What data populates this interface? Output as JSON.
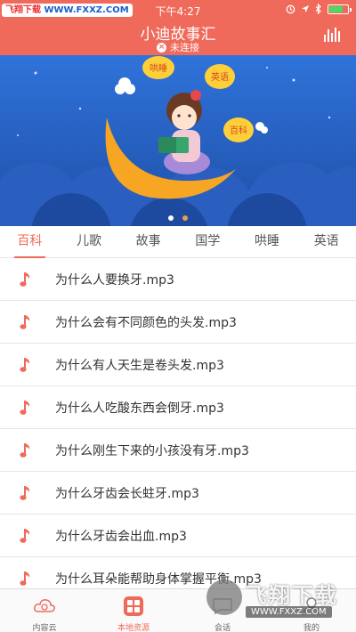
{
  "status_bar": {
    "watermark_left": "飞翔下载",
    "watermark_right": "WWW.FXXZ.COM",
    "time": "下午4:27"
  },
  "header": {
    "title": "小迪故事汇",
    "connection_status": "未连接"
  },
  "banner": {
    "bubbles": [
      "哄睡",
      "英语",
      "百科"
    ],
    "dot_count": 2,
    "active_dot": 0
  },
  "tabs": [
    "百科",
    "儿歌",
    "故事",
    "国学",
    "哄睡",
    "英语"
  ],
  "active_tab": 0,
  "list_items": [
    "为什么人要换牙.mp3",
    "为什么会有不同颜色的头发.mp3",
    "为什么有人天生是卷头发.mp3",
    "为什么人吃酸东西会倒牙.mp3",
    "为什么刚生下来的小孩没有牙.mp3",
    "为什么牙齿会长蛀牙.mp3",
    "为什么牙齿会出血.mp3",
    "为什么耳朵能帮助身体掌握平衡.mp3"
  ],
  "tabbar": [
    {
      "label": "内容云",
      "icon": "cloud-icon"
    },
    {
      "label": "本地资源",
      "icon": "grid-icon"
    },
    {
      "label": "会话",
      "icon": "chat-icon"
    },
    {
      "label": "我的",
      "icon": "user-icon"
    }
  ],
  "active_tabbar": 1,
  "watermark": {
    "title": "飞翔下载",
    "url": "WWW.FXXZ.COM"
  },
  "colors": {
    "accent": "#f06a5b",
    "banner_bg": "#2d6bd4"
  }
}
